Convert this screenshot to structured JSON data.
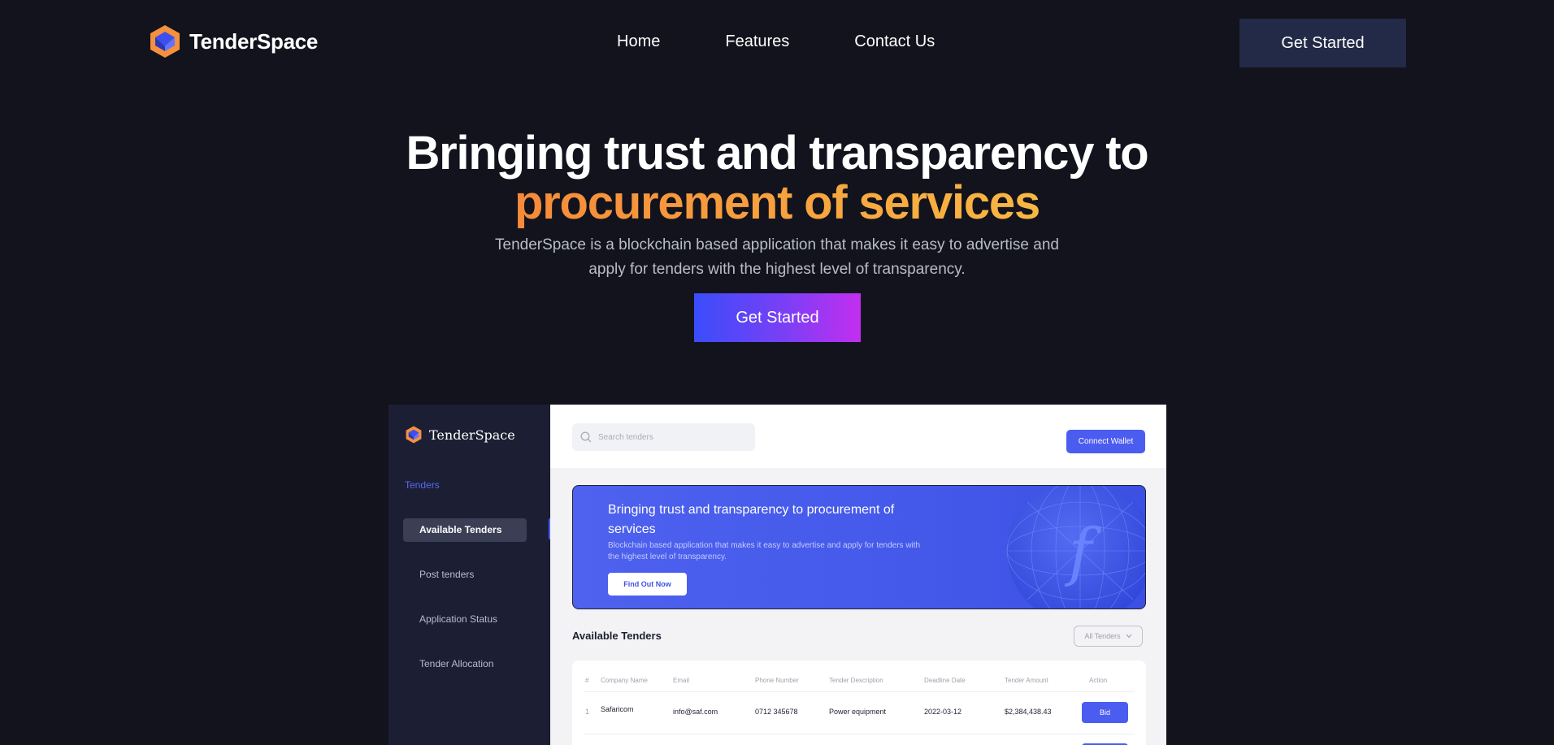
{
  "nav": {
    "brand": "TenderSpace",
    "links": [
      "Home",
      "Features",
      "Contact Us"
    ],
    "cta": "Get Started"
  },
  "hero": {
    "title_line1": "Bringing trust and transparency to",
    "title_line2": "procurement of services",
    "subtitle_line1": "TenderSpace is a blockchain based application that makes it easy to advertise and",
    "subtitle_line2": "apply for tenders with the highest level of transparency.",
    "cta": "Get Started"
  },
  "preview": {
    "brand": "TenderSpace",
    "sidebar": {
      "section": "Tenders",
      "items": [
        "Available Tenders",
        "Post tenders",
        "Application Status",
        "Tender Allocation"
      ],
      "active": "Available Tenders"
    },
    "search": {
      "placeholder": "Search tenders"
    },
    "connect_wallet": "Connect Wallet",
    "banner": {
      "title": "Bringing trust and transparency to procurement of services",
      "subtitle": "Blockchain based application that makes it easy to advertise and apply for tenders with the highest level of transparency.",
      "button": "Find Out Now"
    },
    "tenders_title": "Available Tenders",
    "filter": "All Tenders",
    "table": {
      "headers": [
        "#",
        "Company Name",
        "Email",
        "Phone Number",
        "Tender Description",
        "Deadline Date",
        "Tender Amount",
        "Action"
      ],
      "rows": [
        [
          "1",
          "Safaricom",
          "info@saf.com",
          "0712 345678",
          "Power equipment",
          "2022-03-12",
          "$2,384,438.43",
          "Bid"
        ]
      ]
    }
  },
  "colors": {
    "background": "#12131d",
    "nav_button": "#222a47",
    "accent_orange": "#f7a63f",
    "primary_blue": "#4b5cf0",
    "gradient_purple": "#c32ef0"
  }
}
